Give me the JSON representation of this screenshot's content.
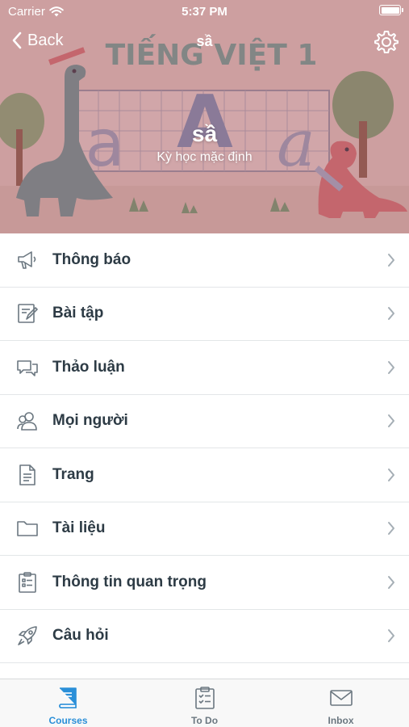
{
  "status_bar": {
    "carrier": "Carrier",
    "time": "5:37 PM"
  },
  "nav": {
    "back_label": "Back",
    "title": "sầ"
  },
  "course": {
    "name": "sầ",
    "term": "Kỳ học mặc định",
    "banner_text": "TIẾNG VIỆT 1",
    "banner_letters": [
      "a",
      "A",
      "a"
    ]
  },
  "menu": [
    {
      "label": "Thông báo",
      "icon": "megaphone-icon"
    },
    {
      "label": "Bài tập",
      "icon": "assignment-icon"
    },
    {
      "label": "Thảo luận",
      "icon": "discussion-icon"
    },
    {
      "label": "Mọi người",
      "icon": "people-icon"
    },
    {
      "label": "Trang",
      "icon": "page-icon"
    },
    {
      "label": "Tài liệu",
      "icon": "folder-icon"
    },
    {
      "label": "Thông tin quan trọng",
      "icon": "syllabus-icon"
    },
    {
      "label": "Câu hỏi",
      "icon": "rocket-icon"
    }
  ],
  "tabs": [
    {
      "label": "Courses",
      "icon": "courses-icon",
      "active": true
    },
    {
      "label": "To Do",
      "icon": "todo-icon",
      "active": false
    },
    {
      "label": "Inbox",
      "icon": "inbox-icon",
      "active": false
    }
  ],
  "colors": {
    "accent": "#2a8fd8",
    "text": "#2d3b45",
    "muted": "#6b7780",
    "overlay": "#9e465a"
  }
}
